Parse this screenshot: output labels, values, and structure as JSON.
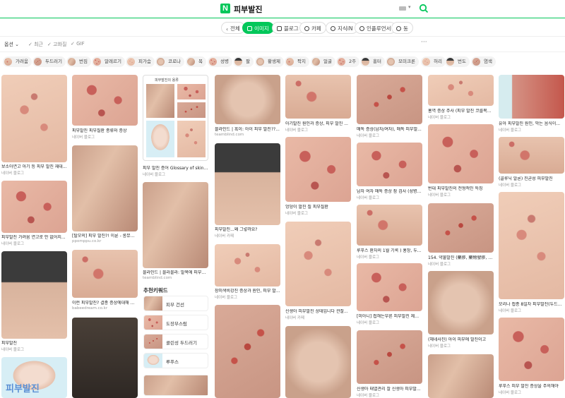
{
  "header": {
    "logo": "N",
    "query": "피부발진"
  },
  "tabs": [
    {
      "label": "전체"
    },
    {
      "label": "이미지",
      "active": true
    },
    {
      "label": "블로그"
    },
    {
      "label": "카페"
    },
    {
      "label": "지식iN"
    },
    {
      "label": "인플루언서"
    },
    {
      "label": "동"
    }
  ],
  "more_label": "···",
  "options": {
    "label": "옵션",
    "filters": [
      "최근",
      "고화질",
      "GIF"
    ]
  },
  "chips": [
    "가려움",
    "두드러기",
    "번짐",
    "알레르기",
    "피가슴",
    "코로나",
    "목",
    "성병",
    "팔",
    "황생제",
    "팍지",
    "얼굴",
    "2주",
    "홍터",
    "모미크론",
    "허리",
    "번도",
    "염색"
  ],
  "colors": {
    "brand": "#03c75a"
  },
  "columns": [
    [
      {
        "caption": "보소아연고 아기 등 피부 발진 재대...",
        "source": "네이버 블로그"
      },
      {
        "caption": "피부발진 가려움 연고로 안 없어지...",
        "source": "네이버 블로그"
      },
      {
        "caption": "피부발진",
        "source": "네이버 블로그"
      },
      {
        "caption": "",
        "source": "",
        "badge": "피부발진"
      }
    ],
    [
      {
        "caption": "피부발진 피부질환 종류와 증상",
        "source": "네이버 블로그"
      },
      {
        "caption": "[탈모의] 피부 발진?! 이룬 - 롱뮤자...",
        "source": "ppomppu.co.kr"
      },
      {
        "caption": "이런 피부발진? 결종 증상에대해 아...",
        "source": "babeedream.co.kr"
      },
      {
        "caption": "",
        "source": ""
      }
    ],
    [
      {
        "caption": "피부 발진 증어 Glossary of skin ras...",
        "source": "네이버 블로그",
        "doc_title": "피부발진의 용류"
      },
      {
        "caption": "블라인드 | 블라블라: 발목에 피부발...",
        "source": "teamblind.com"
      }
    ],
    [
      {
        "caption": "블라인드 | 흑이: 아이 피부 발진??...",
        "source": "teamblind.com"
      },
      {
        "caption": "피부발진...왜 그렇까요?",
        "source": "네이버 카페"
      },
      {
        "caption": "장미색비강진 증상과 원인, 피부 발...",
        "source": "네이버 블로그"
      },
      {
        "caption": "",
        "source": ""
      }
    ],
    [
      {
        "caption": "아기발진 원인과 증상, 피부 발진 ...",
        "source": "네이버 블로그"
      },
      {
        "caption": "엉덩이 발진 질 피부질환",
        "source": "네이버 블로그"
      },
      {
        "caption": "신생아 피부발진 상태입니다 관찰...",
        "source": "네이버 카페"
      },
      {
        "caption": "",
        "source": ""
      }
    ],
    [
      {
        "caption": "매독 증상(남자/여자), 매독 피부발...",
        "source": "네이버 블로그"
      },
      {
        "caption": "남자 여자 매독 증상 잠 검사 (성병...",
        "source": "네이버 블로그"
      },
      {
        "caption": "루푸스 환자의 1월 기록 ) 홍창, 두...",
        "source": "네이버 블로그"
      },
      {
        "caption": "[미아니] 접해는부른 피부발진 체어...",
        "source": "네이버 블로그"
      },
      {
        "caption": "신생아 태열관리 잘 신생아 피부발...",
        "source": "네이버 블로그"
      }
    ],
    [
      {
        "caption": "홍역 증상 주사 (피부 발진 코를목...",
        "source": "네이버 블로그"
      },
      {
        "caption": "번대 피부발진의 전형적인 특징",
        "source": "네이버 블로그"
      },
      {
        "caption": "154. 약물발진 (藥疹, 藥物發疹, Dru...",
        "source": "네이버 블로그"
      },
      {
        "caption": "(헤네사진) 아이 피부에 발진이고",
        "source": "네이버 블로그"
      },
      {
        "caption": "",
        "source": ""
      }
    ],
    [
      {
        "caption": "유아 피부발진 원인, 막는 음식이...",
        "source": "네이버 블로그"
      },
      {
        "caption": "(골루닉 알론) 진균성 피부발진",
        "source": "네이버 블로그"
      },
      {
        "caption": "모리나 접종 8일차 피부발진(두드러...",
        "source": "네이버 블로그"
      },
      {
        "caption": "루푸스 피부 발진 증상을 주의해야",
        "source": "네이버 블로그"
      }
    ]
  ],
  "keywords": {
    "title": "추천키워드",
    "items": [
      "피부 건선",
      "도장부스럼",
      "콜린성 두드러기",
      "루푸스"
    ]
  }
}
